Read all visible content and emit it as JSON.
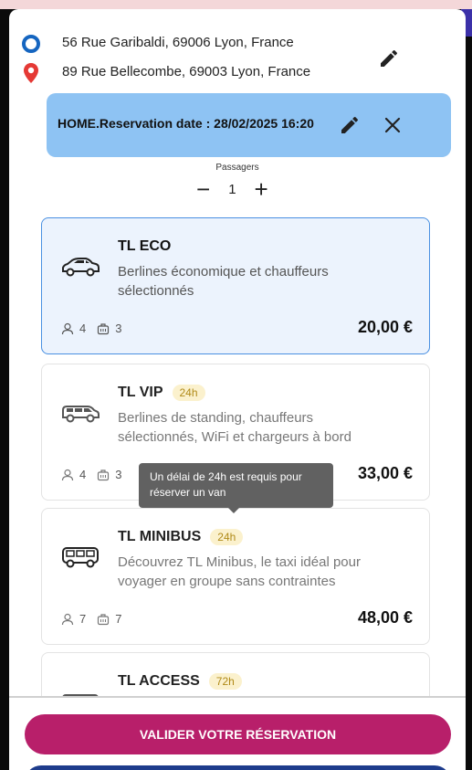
{
  "addresses": {
    "origin": "56 Rue Garibaldi, 69006 Lyon, France",
    "destination": "89 Rue Bellecombe, 69003 Lyon, France"
  },
  "reservation_banner": {
    "text": "HOME.Reservation date : 28/02/2025 16:20"
  },
  "passengers": {
    "label": "Passagers",
    "value": "1",
    "minus": "−",
    "plus": "+"
  },
  "cards": [
    {
      "title": "TL ECO",
      "badge": "",
      "description": "Berlines économique et chauffeurs sélectionnés",
      "seats": "4",
      "luggage": "3",
      "price": "20,00 €",
      "selected": true,
      "vehicle_icon": "car-icon"
    },
    {
      "title": "TL VIP",
      "badge": "24h",
      "description": "Berlines de standing, chauffeurs sélectionnés, WiFi et chargeurs à bord",
      "seats": "4",
      "luggage": "3",
      "price": "33,00 €",
      "selected": false,
      "vehicle_icon": "suv-icon"
    },
    {
      "title": "TL MINIBUS",
      "badge": "24h",
      "description": "Découvrez TL Minibus, le taxi idéal pour voyager en groupe sans contraintes",
      "seats": "7",
      "luggage": "7",
      "price": "48,00 €",
      "selected": false,
      "vehicle_icon": "minibus-icon"
    },
    {
      "title": "TL ACCESS",
      "badge": "72h",
      "description": "",
      "seats": "",
      "luggage": "",
      "price": "",
      "selected": false,
      "vehicle_icon": "van-icon"
    }
  ],
  "tooltip": {
    "text": "Un délai de 24h est requis pour réserver un van"
  },
  "footer": {
    "validate_label": "VALIDER VOTRE RÉSERVATION"
  },
  "colors": {
    "primary_blue": "#1565c0",
    "destination_red": "#e53935",
    "banner_blue": "#8ec3f3",
    "selected_border": "#4a90e2",
    "cta_magenta": "#b81f6a",
    "badge_bg": "#fbf1cd",
    "badge_text": "#b08a18"
  }
}
